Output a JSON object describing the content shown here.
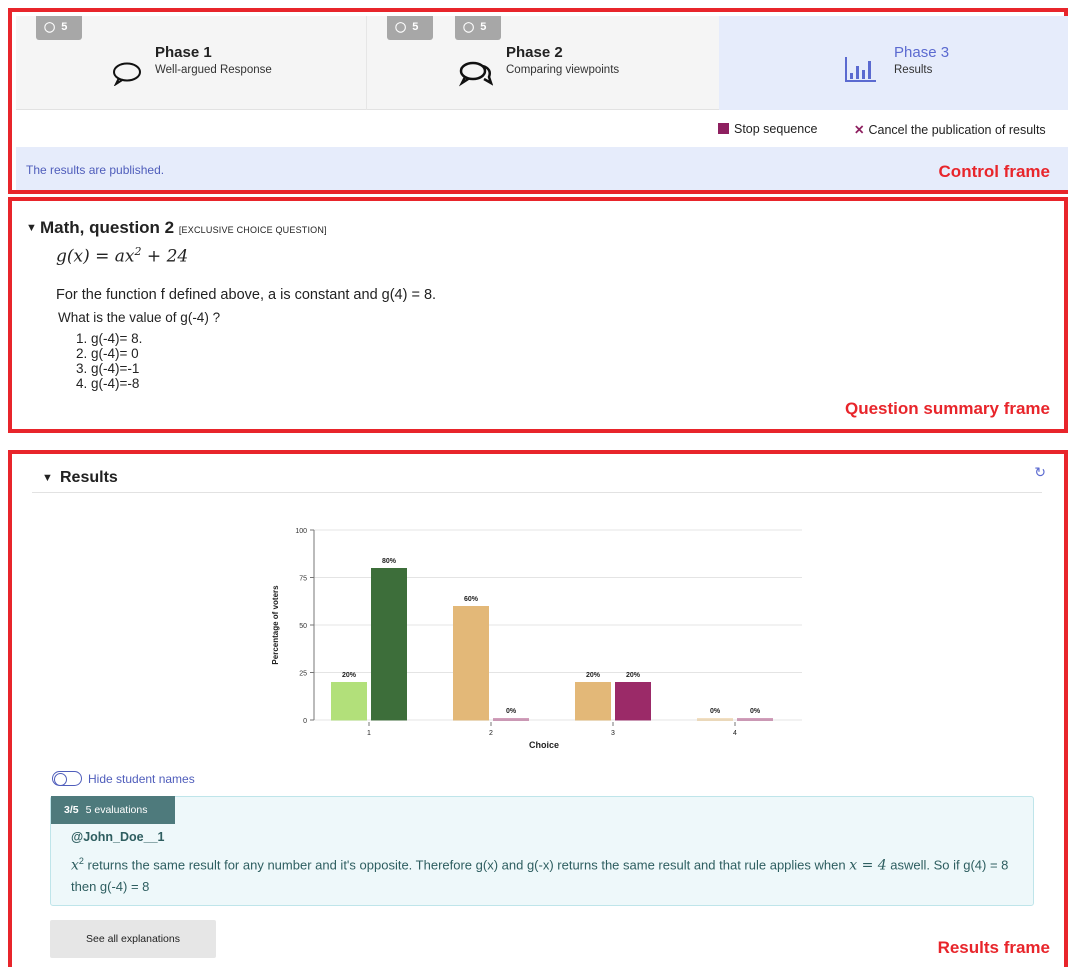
{
  "phases": [
    {
      "title": "Phase 1",
      "subtitle": "Well-argued Response",
      "badge": "5",
      "icon": "speech-bubble-icon"
    },
    {
      "title": "Phase 2",
      "subtitle": "Comparing viewpoints",
      "badge": "5",
      "badge2": "5",
      "icon": "two-speech-bubbles-icon"
    },
    {
      "title": "Phase 3",
      "subtitle": "Results",
      "icon": "bar-chart-icon"
    }
  ],
  "actions": {
    "stop": "Stop sequence",
    "cancel": "Cancel the publication of results"
  },
  "status": "The results are published.",
  "labels": {
    "control": "Control frame",
    "question": "Question summary frame",
    "results": "Results frame"
  },
  "question": {
    "title": "Math, question 2",
    "tag": "[EXCLUSIVE CHOICE QUESTION]",
    "formula_lhs": "g(x) = ax",
    "formula_exp": "2",
    "formula_rhs": " + 24",
    "text1": "For the function f defined above, a is constant and g(4) = 8.",
    "text2": "What is the value of g(-4) ?",
    "options": [
      "1. g(-4)= 8.",
      "2. g(-4)= 0",
      "3. g(-4)=-1",
      "4. g(-4)=-8"
    ]
  },
  "results": {
    "title": "Results",
    "toggle_label": "Hide student names",
    "explanation": {
      "score": "3/5",
      "evaluations": "5 evaluations",
      "user": "@John_Doe__1",
      "var": "x",
      "exp": "2",
      "text_a": " returns the same result for any number and it's opposite. Therefore g(x) and g(-x) returns the same result and that rule applies when ",
      "text_b": "x = 4",
      "text_c": " aswell. So if g(4) = 8 then g(-4) = 8"
    },
    "see_all": "See all explanations"
  },
  "chart_data": {
    "type": "bar",
    "categories": [
      "1",
      "2",
      "3",
      "4"
    ],
    "series": [
      {
        "values": [
          20,
          60,
          20,
          0
        ],
        "colors": [
          "#b2e07a",
          "#e3b878",
          "#e3b878",
          "#e3b878"
        ]
      },
      {
        "values": [
          80,
          0,
          20,
          0
        ],
        "colors": [
          "#3d6e3a",
          "#9b2a68",
          "#9b2a68",
          "#9b2a68"
        ]
      }
    ],
    "data_labels": [
      [
        "20%",
        "60%",
        "20%",
        "0%"
      ],
      [
        "80%",
        "0%",
        "20%",
        "0%"
      ]
    ],
    "xlabel": "Choice",
    "ylabel": "Percentage of voters",
    "yticks": [
      0,
      25,
      50,
      75,
      100
    ],
    "ylim": [
      0,
      100
    ],
    "grid": true
  }
}
